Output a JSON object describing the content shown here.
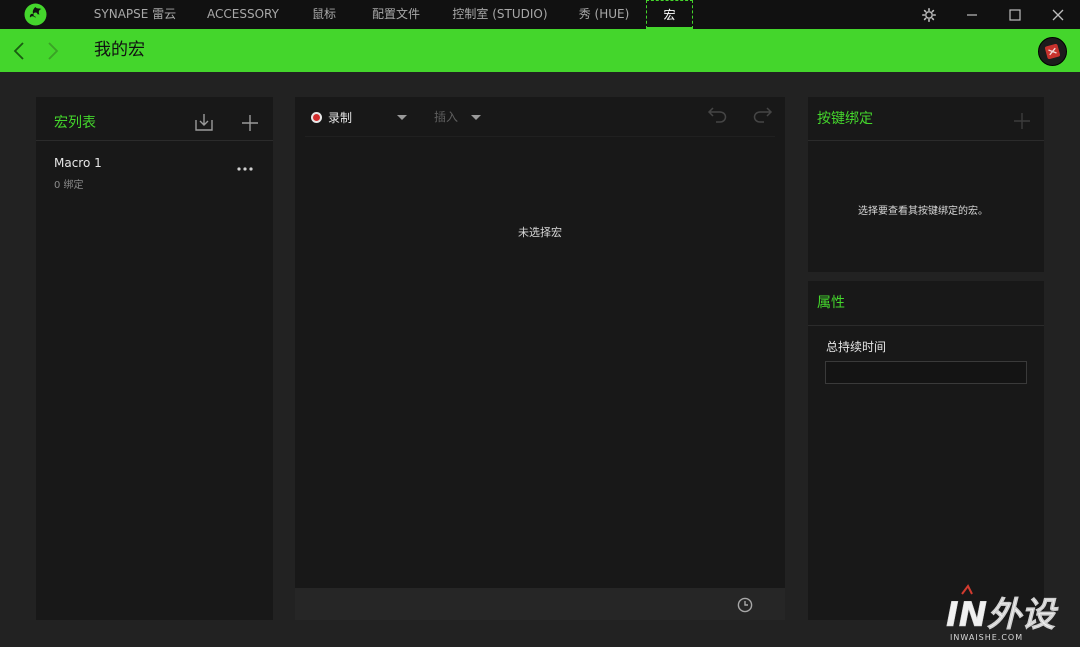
{
  "app": {
    "tabs": [
      {
        "label": "SYNAPSE 雷云"
      },
      {
        "label": "ACCESSORY"
      },
      {
        "label": "鼠标"
      },
      {
        "label": "配置文件"
      },
      {
        "label": "控制室 (STUDIO)"
      },
      {
        "label": "秀 (HUE)"
      },
      {
        "label": "宏"
      }
    ],
    "active_tab": "宏",
    "accent_color": "#44d62c"
  },
  "header": {
    "title": "我的宏"
  },
  "macro_list": {
    "title": "宏列表",
    "items": [
      {
        "name": "Macro 1",
        "bindings": "0 绑定"
      }
    ]
  },
  "editor": {
    "record_label": "录制",
    "insert_label": "插入",
    "empty_message": "未选择宏"
  },
  "key_binding": {
    "title": "按键绑定",
    "message": "选择要查看其按键绑定的宏。"
  },
  "properties": {
    "title": "属性",
    "duration_label": "总持续时间",
    "duration_value": ""
  },
  "watermark": {
    "logo_text": "IN外设",
    "sub_text": "INWAISHE.COM"
  }
}
